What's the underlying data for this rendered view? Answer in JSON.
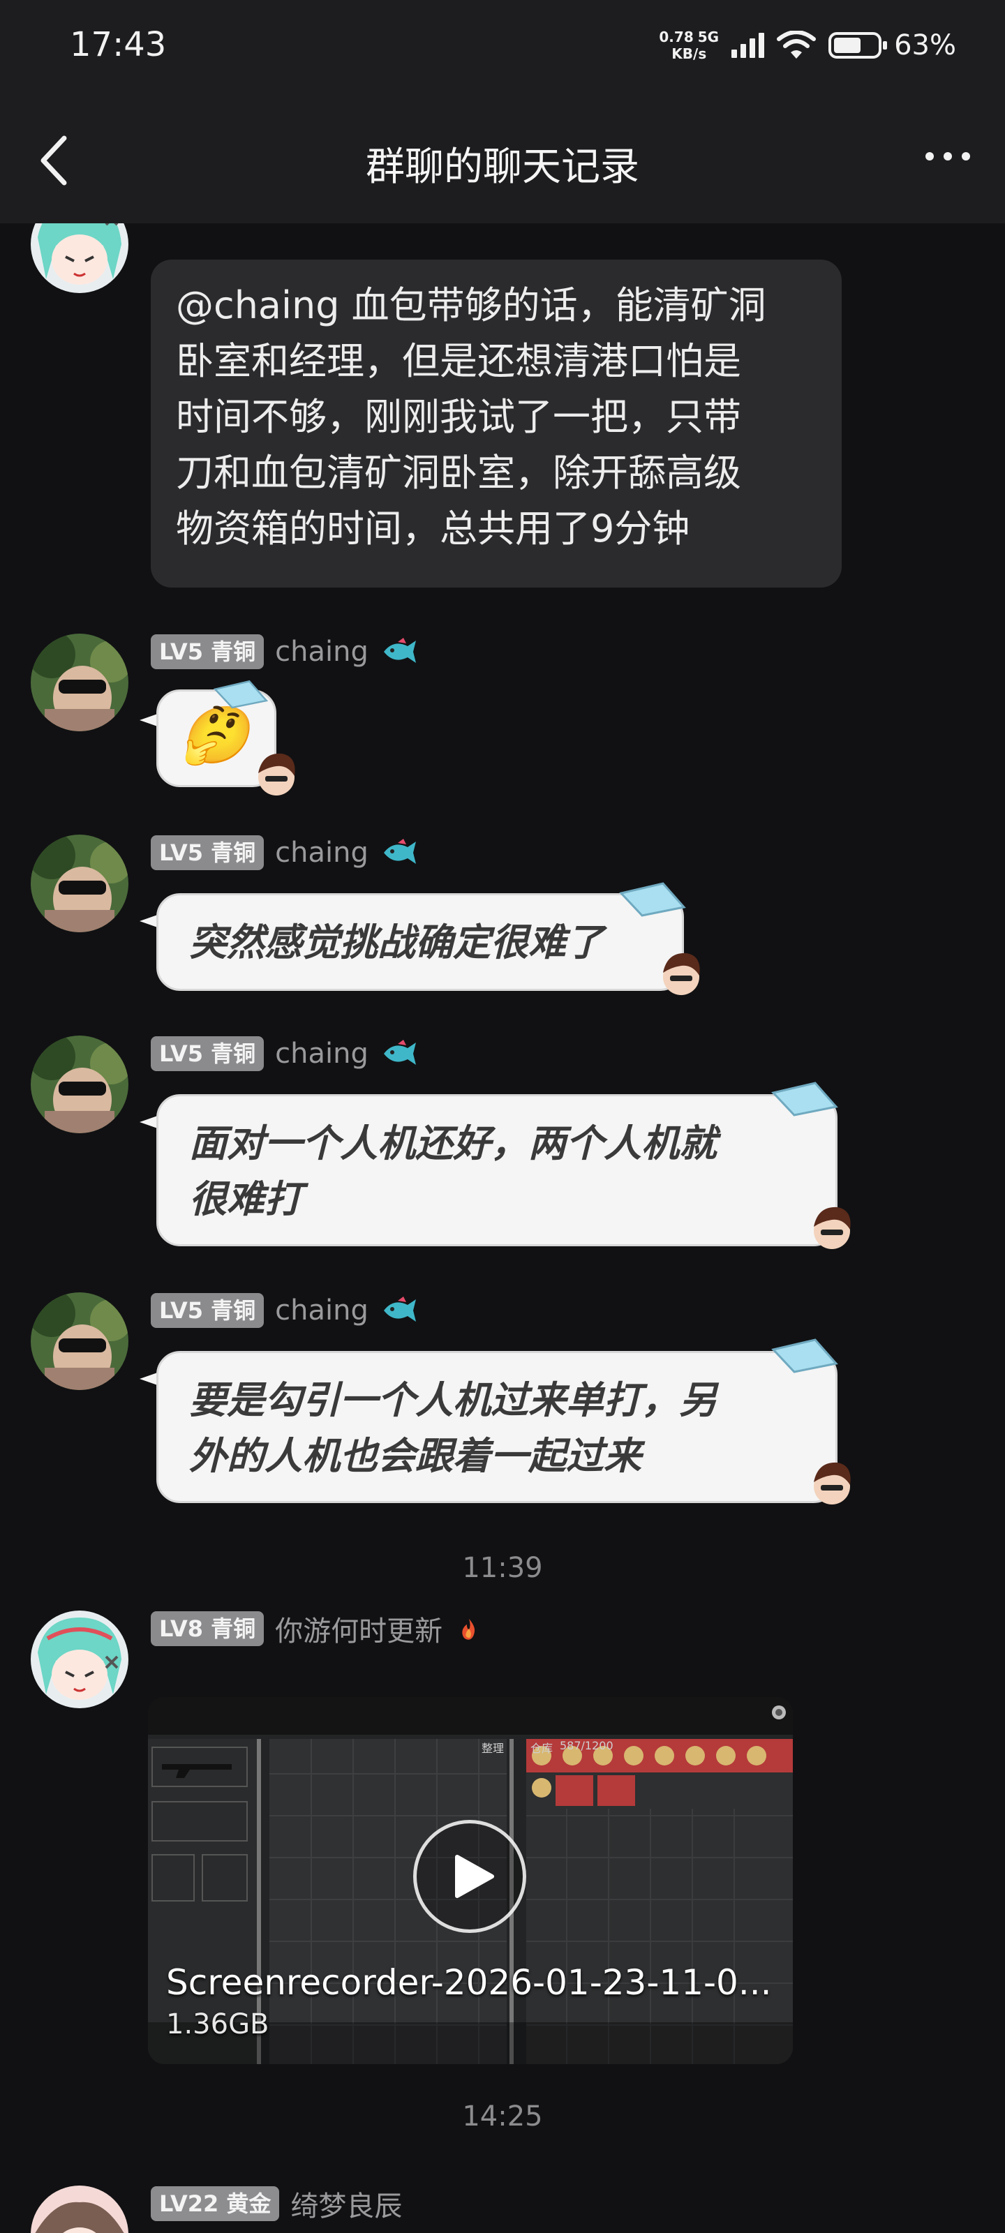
{
  "status_bar": {
    "time": "17:43",
    "net_speed_value": "0.78",
    "net_speed_unit": "KB/s",
    "network": "5G",
    "battery_percent": "63%",
    "battery_level": 0.63
  },
  "header": {
    "title": "群聊的聊天记录"
  },
  "messages": [
    {
      "text_lines": [
        "@chaing 血包带够的话，能清矿洞",
        "卧室和经理，但是还想清港口怕是",
        "时间不够，刚刚我试了一把，只带",
        "刀和血包清矿洞卧室，除开舔高级",
        "物资箱的时间，总共用了9分钟"
      ]
    },
    {
      "level": "LV5 青铜",
      "nickname": "chaing",
      "text": "🤔"
    },
    {
      "level": "LV5 青铜",
      "nickname": "chaing",
      "text": "突然感觉挑战确定很难了"
    },
    {
      "level": "LV5 青铜",
      "nickname": "chaing",
      "text_lines": [
        "面对一个人机还好，两个人机就",
        "很难打"
      ]
    },
    {
      "level": "LV5 青铜",
      "nickname": "chaing",
      "text_lines": [
        "要是勾引一个人机过来单打，另",
        "外的人机也会跟着一起过来"
      ]
    },
    {
      "level": "LV8 青铜",
      "nickname": "你游何时更新",
      "video": {
        "file_name": "Screenrecorder-2026-01-23-11-0...",
        "file_size": "1.36GB",
        "thumb_labels": {
          "warehouse": "仓库",
          "capacity": "587/1200",
          "sort": "整理"
        }
      }
    },
    {
      "level": "LV22 黄金",
      "nickname": "绮梦良辰"
    }
  ],
  "time_separators": [
    "11:39",
    "14:25"
  ]
}
